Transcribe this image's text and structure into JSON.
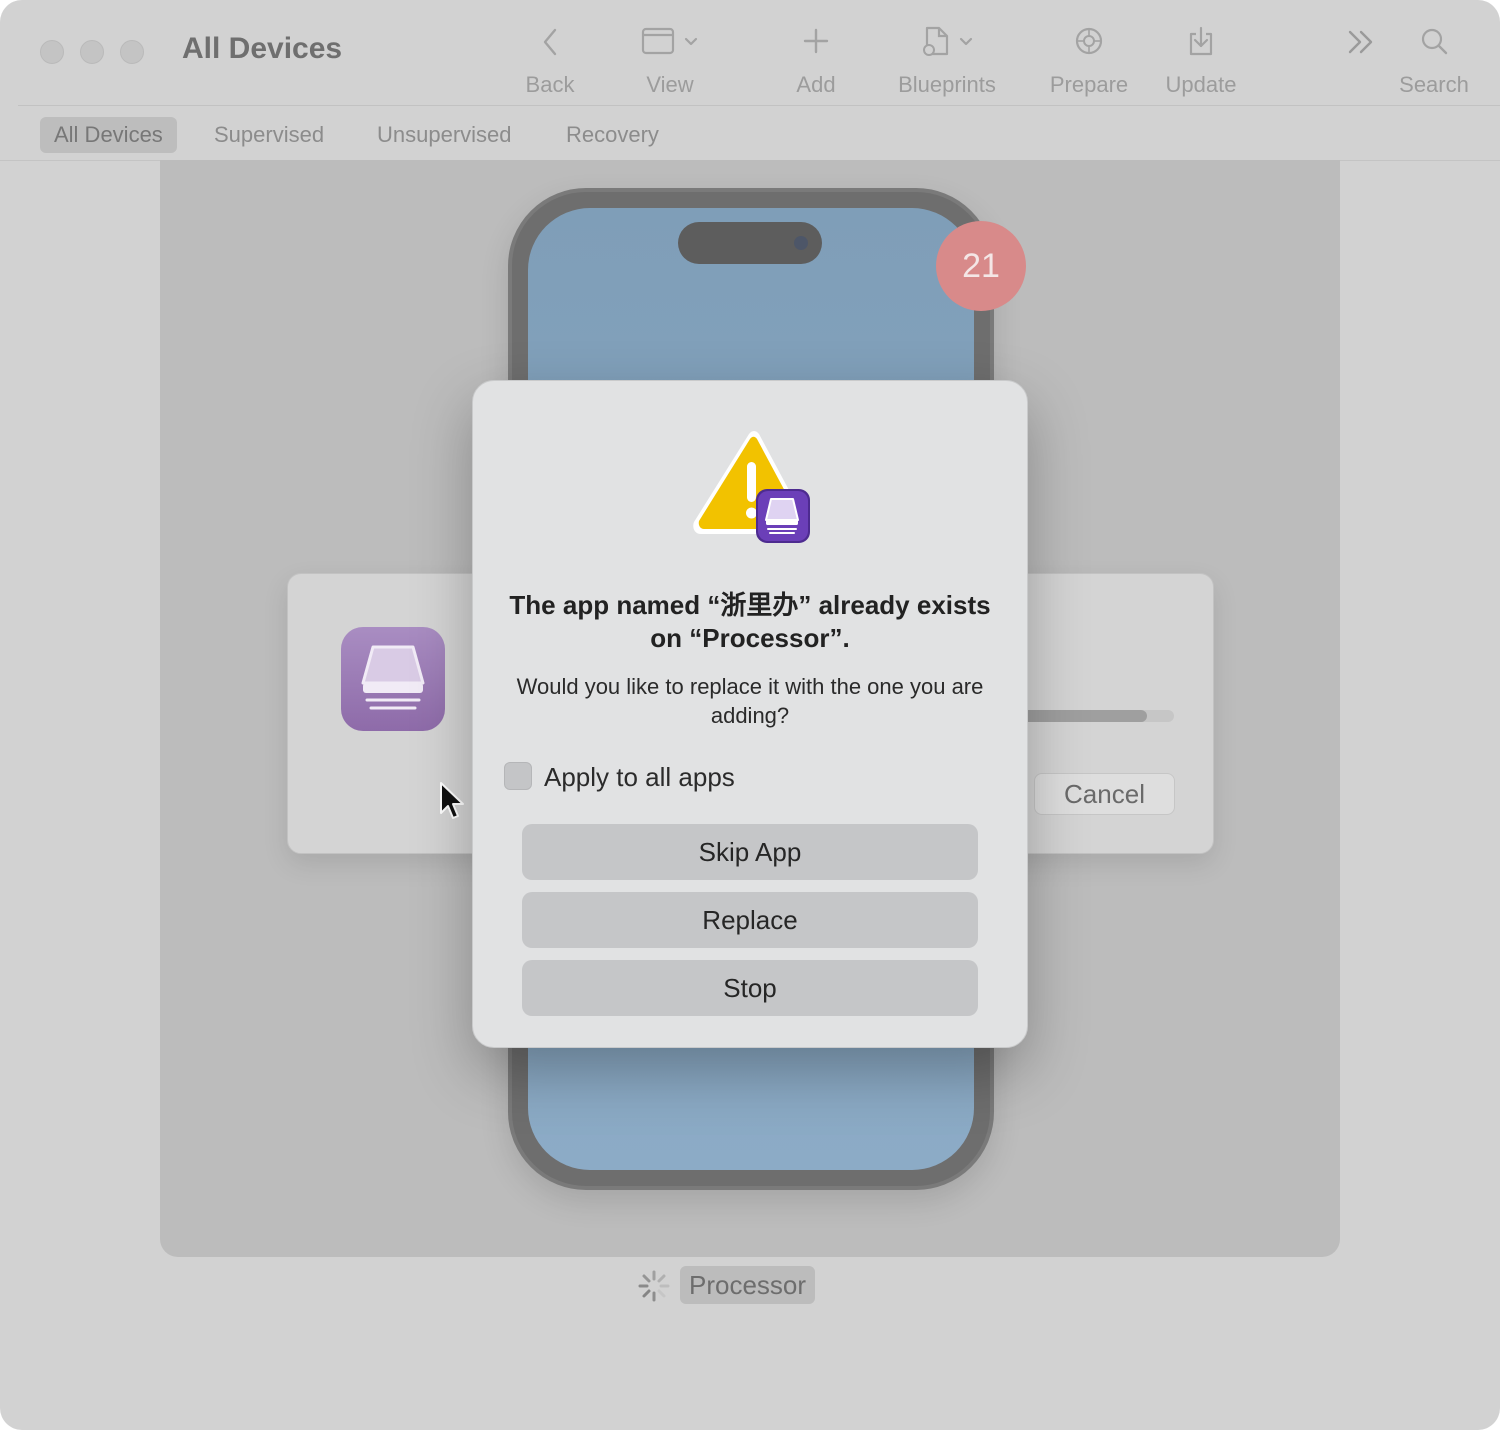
{
  "window": {
    "title": "All Devices"
  },
  "toolbar": {
    "back_label": "Back",
    "view_label": "View",
    "add_label": "Add",
    "blueprints_label": "Blueprints",
    "prepare_label": "Prepare",
    "update_label": "Update",
    "search_label": "Search"
  },
  "tabs": [
    {
      "label": "All Devices",
      "active": true
    },
    {
      "label": "Supervised",
      "active": false
    },
    {
      "label": "Unsupervised",
      "active": false
    },
    {
      "label": "Recovery",
      "active": false
    }
  ],
  "device": {
    "name": "Processor",
    "badge_count": "21"
  },
  "progress_panel": {
    "cancel_label": "Cancel",
    "progress_fraction": 0.82
  },
  "dialog": {
    "title": "The app named “浙里办” already exists on “Processor”.",
    "message": "Would you like to replace it with the one you are adding?",
    "checkbox_label": "Apply to all apps",
    "checkbox_checked": false,
    "skip_label": "Skip App",
    "replace_label": "Replace",
    "stop_label": "Stop"
  },
  "colors": {
    "badge": "#d88a8a",
    "app_icon": "#8e6ba9",
    "warning": "#f2c200"
  }
}
